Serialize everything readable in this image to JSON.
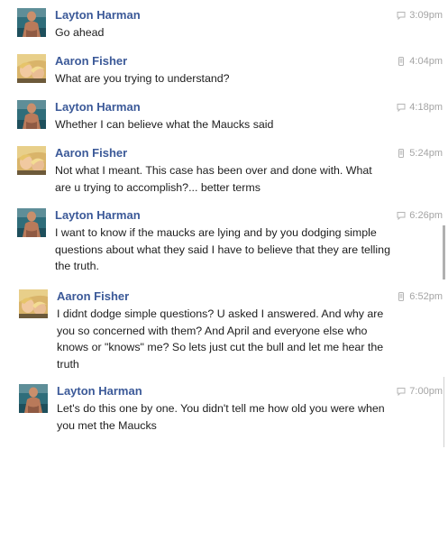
{
  "messages": [
    {
      "sender": "Layton Harman",
      "time": "3:09pm",
      "source": "chat",
      "text": "Go ahead"
    },
    {
      "sender": "Aaron Fisher",
      "time": "4:04pm",
      "source": "mobile",
      "text": "What are you trying to understand?"
    },
    {
      "sender": "Layton Harman",
      "time": "4:18pm",
      "source": "chat",
      "text": "Whether I can believe what the Maucks said"
    },
    {
      "sender": "Aaron Fisher",
      "time": "5:24pm",
      "source": "mobile",
      "text": "Not what I meant. This case has been over and done with. What are u trying to accomplish?... better terms"
    },
    {
      "sender": "Layton Harman",
      "time": "6:26pm",
      "source": "chat",
      "text": "I want to know if the maucks are lying and by you dodging simple questions about what they said I have to believe that they are telling the truth."
    },
    {
      "sender": "Aaron Fisher",
      "time": "6:52pm",
      "source": "mobile",
      "text": "I didnt dodge simple questions? U asked I answered. And why are you so concerned with them? And April and everyone else who knows or \"knows\" me? So lets just cut the bull and let me hear the truth"
    },
    {
      "sender": "Layton Harman",
      "time": "7:00pm",
      "source": "chat",
      "text": "Let's do this one by one. You didn't tell me how old you were when you met the Maucks"
    }
  ],
  "colors": {
    "sender": "#3b5998",
    "text": "#1d1d1d",
    "time": "#a4a4a4",
    "scrollbar": "#c8c8c8"
  },
  "icons": {
    "chat": "chat-bubble-icon",
    "mobile": "mobile-phone-icon"
  }
}
